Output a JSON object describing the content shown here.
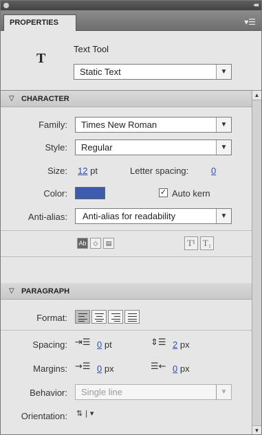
{
  "tab": {
    "label": "PROPERTIES"
  },
  "tool": {
    "icon_letter": "T",
    "name": "Text Tool",
    "type_value": "Static Text"
  },
  "character": {
    "title": "CHARACTER",
    "family_label": "Family:",
    "family_value": "Times New Roman",
    "style_label": "Style:",
    "style_value": "Regular",
    "size_label": "Size:",
    "size_value": "12",
    "size_unit": "pt",
    "letter_spacing_label": "Letter spacing:",
    "letter_spacing_value": "0",
    "color_label": "Color:",
    "color_value": "#3b5dab",
    "auto_kern_label": "Auto kern",
    "auto_kern_checked": true,
    "anti_alias_label": "Anti-alias:",
    "anti_alias_value": "Anti-alias for readability",
    "superscript_glyph": "T¹",
    "subscript_glyph": "T₁"
  },
  "paragraph": {
    "title": "PARAGRAPH",
    "format_label": "Format:",
    "spacing_label": "Spacing:",
    "indent_value": "0",
    "indent_unit": "pt",
    "line_spacing_value": "2",
    "line_spacing_unit": "px",
    "margins_label": "Margins:",
    "left_margin_value": "0",
    "left_margin_unit": "px",
    "right_margin_value": "0",
    "right_margin_unit": "px",
    "behavior_label": "Behavior:",
    "behavior_value": "Single line",
    "orientation_label": "Orientation:"
  },
  "icons": {
    "collapse": "collapse-icon",
    "panel_menu": "panel-menu-icon",
    "selectable": "selectable-text-icon",
    "render_html": "render-html-icon",
    "border": "show-border-icon",
    "superscript": "superscript-icon",
    "subscript": "subscript-icon"
  }
}
